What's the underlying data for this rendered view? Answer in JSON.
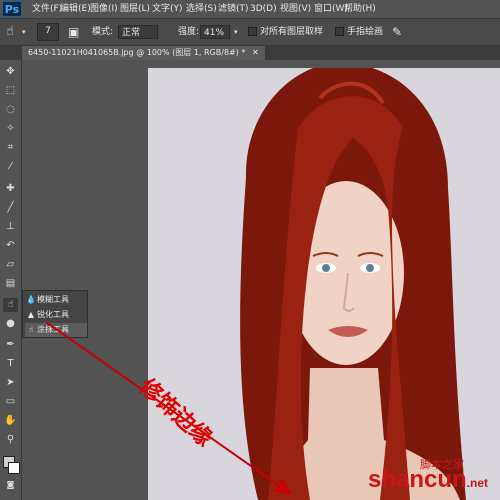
{
  "app": {
    "logo": "Ps"
  },
  "menus": [
    "文件(F)",
    "编辑(E)",
    "图像(I)",
    "图层(L)",
    "文字(Y)",
    "选择(S)",
    "滤镜(T)",
    "3D(D)",
    "视图(V)",
    "窗口(W)",
    "帮助(H)"
  ],
  "options": {
    "brush_size": "7",
    "mode_label": "模式:",
    "mode_value": "正常",
    "strength_label": "强度:",
    "strength_value": "41%",
    "sample_all_layers": "对所有图层取样",
    "finger_painting": "手指绘画"
  },
  "document": {
    "tab_title": "6450-11021H041065B.jpg @ 100% (图层 1, RGB/8#) *"
  },
  "flyout": {
    "items": [
      "模糊工具",
      "锐化工具",
      "涂抹工具"
    ]
  },
  "annotation": {
    "text": "修饰边缘"
  },
  "watermark": {
    "main": "shancun",
    "domain": ".net",
    "sub": "脚本之家"
  },
  "colors": {
    "annotation": "#e00000",
    "watermark": "#c81616",
    "hair": "#8e1c0f"
  }
}
